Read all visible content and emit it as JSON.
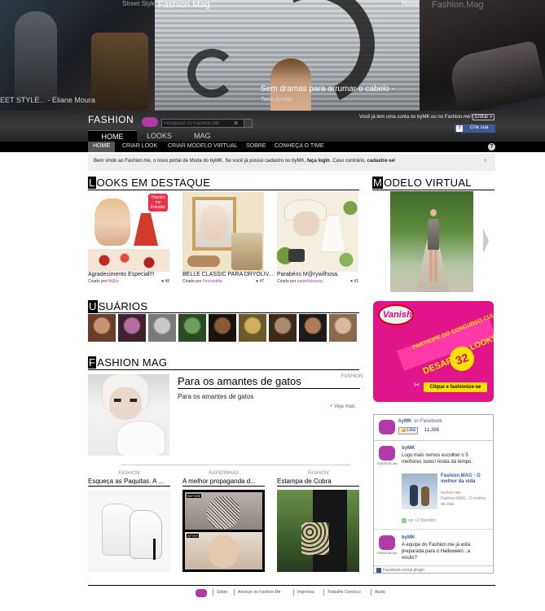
{
  "hero": {
    "left_top_text": "Street Style",
    "title": "Fashion.Mag",
    "home_label": "Home",
    "right_top_text": "Fashion.Mag",
    "left_caption": "EET STYLE... - Eliane Moura",
    "caption": "Sem dramas para arrumar o cabelo -",
    "caption_sub": "Taciu Arruda"
  },
  "header": {
    "logo_text": "FASHION",
    "search_placeholder": "Pesquisar no Fashion.Me",
    "search_clear": "⊗",
    "account_prompt": "Você já tem uma conta no byMK ou no Fashion.me?",
    "enter_label": "Entrar »",
    "facebook_label": "Crie sua",
    "facebook_icon": "f"
  },
  "main_tabs": [
    {
      "label": "HOME"
    },
    {
      "label": "LOOKS"
    },
    {
      "label": "MAG"
    }
  ],
  "subnav": [
    {
      "label": "HOME"
    },
    {
      "label": "CRIAR LOOK"
    },
    {
      "label": "CRIAR MODELO VIRTUAL"
    },
    {
      "label": "SOBRE"
    },
    {
      "label": "CONHEÇA O TIME"
    }
  ],
  "help_icon": "?",
  "welcome": {
    "text_before": "Bem vindo ao Fashion.me, o novo portal de Moda do byMK. Se você já possui cadastro no byMK,",
    "login_link": "faça login",
    "text_middle": ". Caso contrário,",
    "signup_link": "cadastre-se",
    "text_end": "!",
    "close": "x"
  },
  "looks_section": {
    "title_cap": "L",
    "title_rest": "OOKS EM DESTAQUE",
    "items": [
      {
        "title": "Agradecimento Especial!!!",
        "created_by": "Criado por",
        "author": "M@ry",
        "likes": "♥ 48",
        "badge": "Thank's my Friends!"
      },
      {
        "title": "BELLE CLASSIC PARA DRYOLIV...",
        "created_by": "Criado por",
        "author": "Fernandita",
        "likes": "♥ 47"
      },
      {
        "title": "Parabéns M@rywilhosa.",
        "created_by": "Criado por",
        "author": "sarjinhasouza",
        "likes": "♥ 41"
      }
    ]
  },
  "modelo_section": {
    "title_cap": "M",
    "title_rest": "ODELO VIRTUAL"
  },
  "users_section": {
    "title_cap": "U",
    "title_rest": "SUÁRIOS",
    "avatars": [
      {
        "c1": "#c99272",
        "c2": "#6b3e2a"
      },
      {
        "c1": "#b36da0",
        "c2": "#40222e"
      },
      {
        "c1": "#c8c8c8",
        "c2": "#7a7a7a"
      },
      {
        "c1": "#6a9e5a",
        "c2": "#2b4a22"
      },
      {
        "c1": "#8a5a3a",
        "c2": "#1a120e"
      },
      {
        "c1": "#d0b060",
        "c2": "#6a5a2a"
      },
      {
        "c1": "#a88a6a",
        "c2": "#3a2a1a"
      },
      {
        "c1": "#b07a5a",
        "c2": "#1e1a1a"
      },
      {
        "c1": "#d8b8a0",
        "c2": "#8a6a4a"
      }
    ]
  },
  "vanish_ad": {
    "logo": "Vanish",
    "line1": "PARTICIPE DO CONCURSO CULTURAL",
    "line2": "DESAFIO",
    "number": "32",
    "line3": "LOOKS",
    "cta": "Clique e fashionize-se",
    "scissors": "✂"
  },
  "mag_section": {
    "title_cap": "F",
    "title_rest": "ASHION MAG",
    "featured": {
      "title": "Para os amantes de gatos",
      "category": "FASHION",
      "excerpt": "Para os amantes de gatos",
      "more": "+ Veja mais"
    },
    "cards": [
      {
        "category": "FASHION",
        "title": "Esqueça as Paquitas. A ..."
      },
      {
        "category": "RAPIDINHAS",
        "title": "A melhor propaganda d...",
        "before": "BEFORE",
        "after": "AFTER"
      },
      {
        "category": "FASHION",
        "title": "Estampa de Cobra"
      }
    ]
  },
  "facebook_widget": {
    "page_name": "byMK",
    "on_text": "on",
    "facebook_text": "Facebook",
    "like_label": "👍Like",
    "like_count": "11,386",
    "logo_label": "FASHION.me",
    "post1_author": "byMK",
    "post1_text": "Logo mais iremos escolher o 5 melhores looks! Ainda dá tempo.",
    "link_title": "Fashion.MAG - O melhor da vida",
    "link_domain": "fashion.me",
    "link_desc": "Fashion.MAG - O melhor da vida",
    "post1_time": "vor 11 Stunden",
    "post2_author": "byMK",
    "post2_text": "A equipe do Fashion.me já está preparada para o Halloween...a vocês?",
    "footer": "Facebook social plugin"
  },
  "footer": {
    "links": [
      "Sobre",
      "Anuncie no Fashion.Me",
      "Imprensa",
      "Trabalhe Conosco",
      "Ajuda"
    ]
  }
}
